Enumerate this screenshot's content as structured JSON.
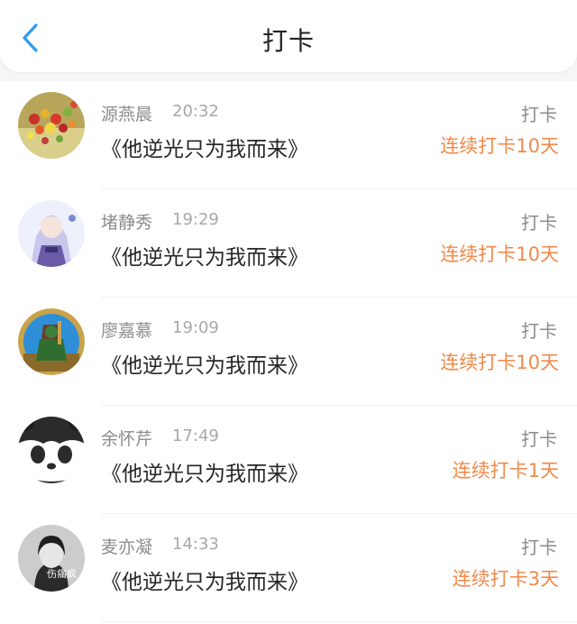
{
  "header": {
    "title": "打卡",
    "back_icon": "chevron-left-icon",
    "accent_color": "#2b9bf4"
  },
  "records": [
    {
      "name": "源燕晨",
      "time": "20:32",
      "book": "《他逆光只为我而来》",
      "action": "打卡",
      "streak": "连续打卡10天",
      "avatar": "candy-avatar"
    },
    {
      "name": "堵静秀",
      "time": "19:29",
      "book": "《他逆光只为我而来》",
      "action": "打卡",
      "streak": "连续打卡10天",
      "avatar": "anime-girl-avatar"
    },
    {
      "name": "廖嘉慕",
      "time": "19:09",
      "book": "《他逆光只为我而来》",
      "action": "打卡",
      "streak": "连续打卡10天",
      "avatar": "game-character-avatar"
    },
    {
      "name": "余怀芹",
      "time": "17:49",
      "book": "《他逆光只为我而来》",
      "action": "打卡",
      "streak": "连续打卡1天",
      "avatar": "panda-avatar"
    },
    {
      "name": "麦亦凝",
      "time": "14:33",
      "book": "《他逆光只为我而来》",
      "action": "打卡",
      "streak": "连续打卡3天",
      "avatar": "portrait-avatar",
      "avatar_text": "伤痛疯"
    }
  ],
  "colors": {
    "streak": "#f08a4b",
    "name": "#8c8c8c",
    "book": "#262626"
  }
}
